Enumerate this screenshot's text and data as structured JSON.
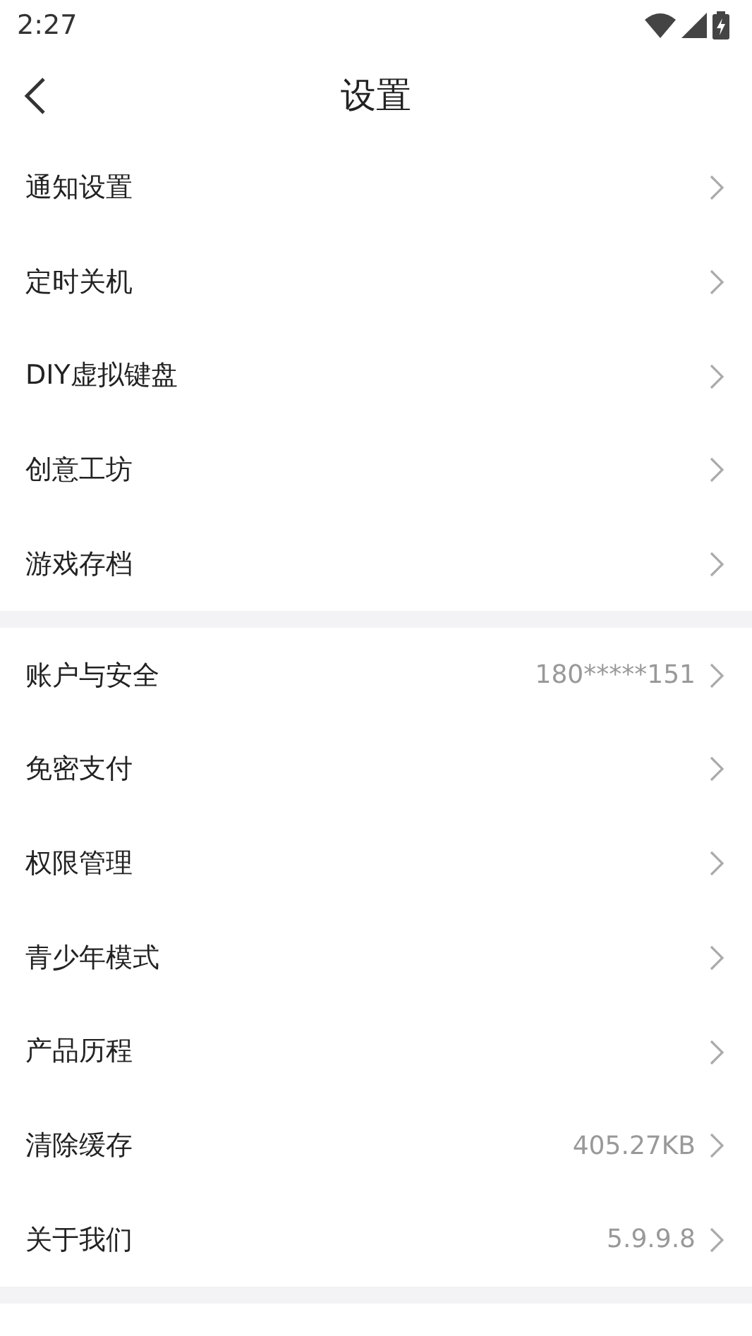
{
  "status_bar": {
    "time": "2:27"
  },
  "header": {
    "title": "设置"
  },
  "groups": [
    {
      "items": [
        {
          "label": "通知设置"
        },
        {
          "label": "定时关机"
        },
        {
          "label": "DIY虚拟键盘"
        },
        {
          "label": "创意工坊"
        },
        {
          "label": "游戏存档"
        }
      ]
    },
    {
      "items": [
        {
          "label": "账户与安全",
          "value": "180*****151"
        },
        {
          "label": "免密支付"
        },
        {
          "label": "权限管理"
        },
        {
          "label": "青少年模式"
        },
        {
          "label": "产品历程"
        },
        {
          "label": "清除缓存",
          "value": "405.27KB"
        },
        {
          "label": "关于我们",
          "value": "5.9.9.8"
        }
      ]
    }
  ]
}
